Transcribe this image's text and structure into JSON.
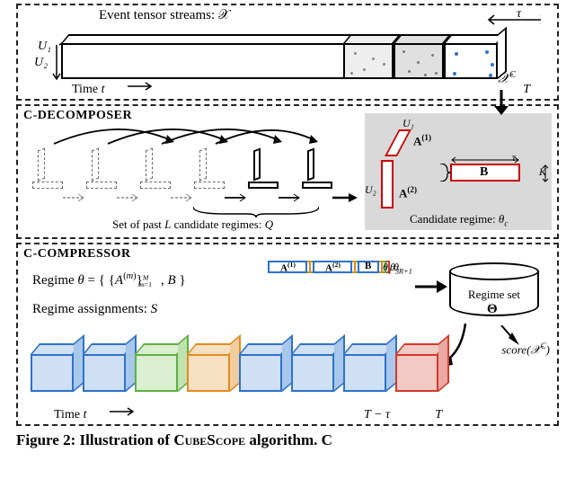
{
  "panel1": {
    "top_label": "Event tensor streams: 𝒳",
    "u1": "U₁",
    "u2": "U₂",
    "tau": "τ",
    "xc": "𝒳",
    "xc_sup": "C",
    "time": "Time t →",
    "T": "T"
  },
  "decomposer": {
    "title": "C-DECOMPOSER",
    "q_label": "Set of past L candidate regimes: Q",
    "u1": "U₁",
    "u2": "U₂",
    "tau": "τ",
    "K": "K",
    "A1": "A",
    "A1_sup": "(1)",
    "A2": "A",
    "A2_sup": "(2)",
    "B": "B",
    "candidate": "Candidate regime: θ_c"
  },
  "compressor": {
    "title": "C-COMPRESSOR",
    "regime_eq": "Regime θ = { {A^(m)}_{m=1}^{M} , B }",
    "assignments": "Regime assignments: S",
    "factor_labels": {
      "A1": "A^(1)",
      "A2": "A^(2)",
      "B": "B"
    },
    "thetas": [
      "θ_{R+1}",
      "θ_3",
      "θ_1"
    ],
    "cyl": {
      "label": "Regime set",
      "symbol": "Θ"
    },
    "score": "score(𝒳^C)",
    "time": "Time t →",
    "Tmtau": "T − τ",
    "T": "T",
    "cube_colors": [
      "#2e72c9",
      "#2e72c9",
      "#5fae46",
      "#e58a1f",
      "#2e72c9",
      "#2e72c9",
      "#2e72c9",
      "#d23a2a"
    ]
  },
  "caption": {
    "prefix": "Figure 2: Illustration of ",
    "name": "CubeScope",
    "suffix": " algorithm. C"
  }
}
